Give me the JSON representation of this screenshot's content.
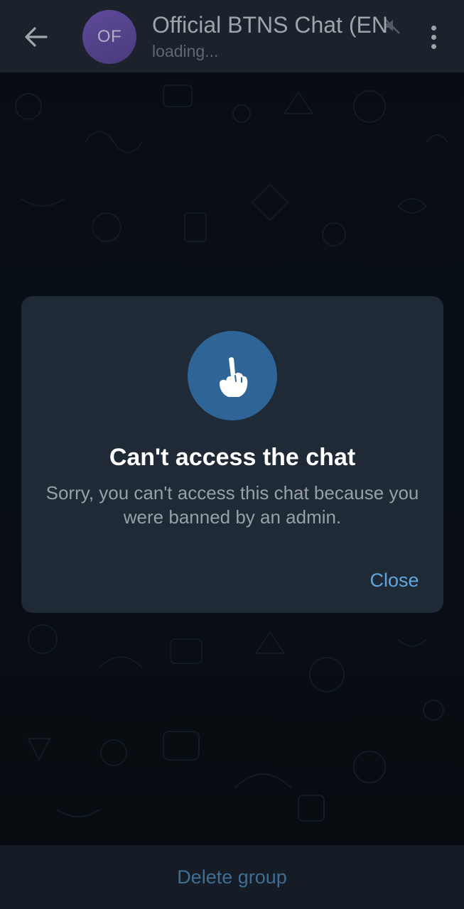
{
  "header": {
    "avatar_initials": "OF",
    "title": "Official BTNS Chat (EN",
    "status": "loading...",
    "back_icon": "arrow-left-icon",
    "mute_icon": "muted-speaker-icon",
    "menu_icon": "more-vertical-icon"
  },
  "dialog": {
    "icon": "raised-finger-hand-icon",
    "title": "Can't access the chat",
    "message": "Sorry, you can't access this chat because you were banned by an admin.",
    "close_label": "Close"
  },
  "bottom_bar": {
    "delete_label": "Delete group"
  },
  "colors": {
    "header_bg": "#1b222b",
    "dialog_bg": "#1f2a36",
    "accent": "#5fa6e0",
    "icon_circle": "#2e6596",
    "avatar": "#6f54b6"
  }
}
